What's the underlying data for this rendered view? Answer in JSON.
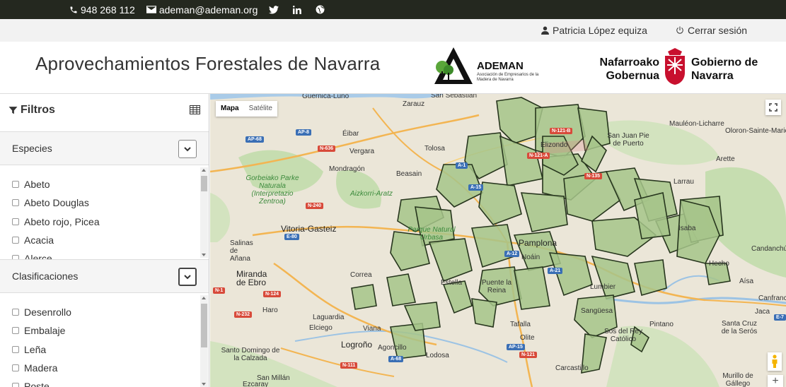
{
  "topbar": {
    "phone": "948 268 112",
    "email": "ademan@ademan.org",
    "social_icons": [
      "twitter-icon",
      "linkedin-icon",
      "globe-icon"
    ]
  },
  "userbar": {
    "user_name": "Patricia López equiza",
    "logout_label": "Cerrar sesión"
  },
  "header": {
    "title": "Aprovechamientos Forestales de Navarra",
    "ademan_logo": {
      "name": "ADEMAN",
      "subtitle": "Asociación de Empresarios de la Madera de Navarra"
    },
    "navarra_logo": {
      "basque": "Nafarroako Gobernua",
      "spanish": "Gobierno de Navarra"
    }
  },
  "sidebar": {
    "filters_label": "Filtros",
    "panels": [
      {
        "label": "Especies",
        "items": [
          "Abeto",
          "Abeto Douglas",
          "Abeto rojo, Picea",
          "Acacia",
          "Alerce"
        ]
      },
      {
        "label": "Clasificaciones",
        "items": [
          "Desenrollo",
          "Embalaje",
          "Leña",
          "Madera",
          "Poste"
        ]
      }
    ]
  },
  "map": {
    "type_buttons": [
      "Mapa",
      "Satélite"
    ],
    "selected_type": "Mapa",
    "places": [
      "San Sebastián",
      "Zarauz",
      "Guernica-Luno",
      "Éibar",
      "Vergara",
      "Tolosa",
      "Mondragón",
      "Beasain",
      "Elizondo",
      "Mauléon-Licharre",
      "Oloron-Sainte-Marie",
      "San Juan Pie de Puerto",
      "Larrau",
      "Arette",
      "Vitoria-Gasteiz",
      "Pamplona",
      "Noáin",
      "Salinas de Añana",
      "Miranda de Ebro",
      "Haro",
      "Laguardia",
      "Elciego",
      "Viana",
      "Logroño",
      "Tafalla",
      "Olite",
      "Lodosa",
      "Sangüesa",
      "Sos del Rey Católico",
      "Pintano",
      "Santa Cruz de la Serós",
      "Jaca",
      "Hecho",
      "Aísa",
      "Canfranc",
      "Candanchú",
      "Carcastillo",
      "Murillo de Gállego",
      "Santo Domingo de la Calzada",
      "San Millán",
      "Ezcaray",
      "Correa",
      "Estella",
      "Puente la Reina",
      "Agoncillo",
      "Lumbier",
      "Isaba"
    ],
    "parks": [
      "Gorbeiako Parke Naturala (Interpretazio Zentroa)",
      "Aizkorri-Aratz",
      "Parque Natural Urbasa"
    ],
    "road_shields": [
      "AP-8",
      "AP-68",
      "N-636",
      "A-1",
      "A-15",
      "N-121-B",
      "N-121-A",
      "N-135",
      "N-240",
      "A-21",
      "A-12",
      "AP-15",
      "N-121",
      "N-232",
      "N-124",
      "N-111",
      "E-80",
      "E-7",
      "A-68",
      "N-1"
    ]
  },
  "colors": {
    "topbar_bg": "#24281f",
    "forest_fill": "#9fbf82",
    "forest_stroke": "#27361e"
  }
}
